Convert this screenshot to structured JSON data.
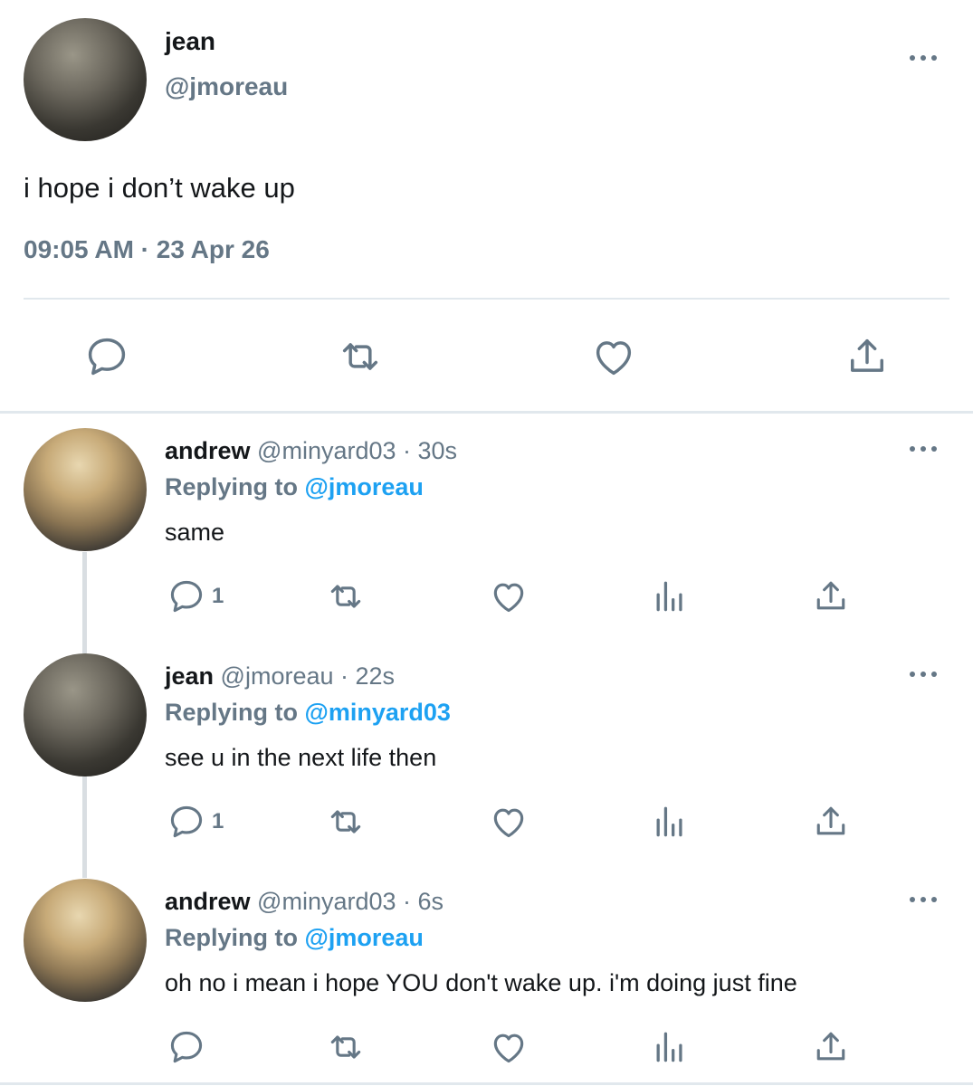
{
  "main_tweet": {
    "name": "jean",
    "handle": "@jmoreau",
    "text": "i hope i don’t wake up",
    "timestamp": "09:05 AM · 23 Apr 26",
    "actions": [
      "reply-icon",
      "retweet-icon",
      "like-icon",
      "share-icon"
    ]
  },
  "replies": [
    {
      "name": "andrew",
      "handle_time": "@minyard03 · 30s",
      "replying_prefix": "Replying to",
      "replying_to": "@jmoreau",
      "text": "same",
      "reply_count": "1"
    },
    {
      "name": "jean",
      "handle_time": "@jmoreau · 22s",
      "replying_prefix": "Replying to",
      "replying_to": "@minyard03",
      "text": "see u in the next life then",
      "reply_count": "1"
    },
    {
      "name": "andrew",
      "handle_time": "@minyard03 · 6s",
      "replying_prefix": "Replying to",
      "replying_to": "@jmoreau",
      "text": "oh no i mean i hope YOU don't wake up. i'm doing just fine",
      "reply_count": ""
    }
  ],
  "colors": {
    "secondary_text": "#657786",
    "mention": "#1da1f2",
    "divider": "#e1e8ed"
  }
}
